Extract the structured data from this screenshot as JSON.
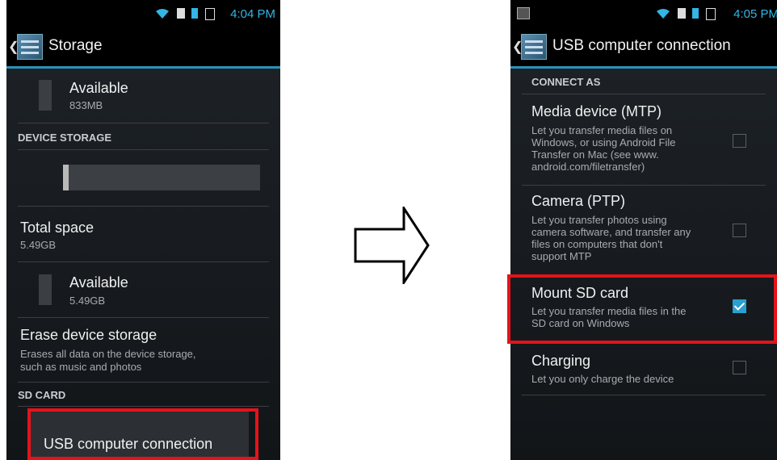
{
  "left": {
    "status": {
      "time": "4:04 PM"
    },
    "title": "Storage",
    "available1": {
      "label": "Available",
      "value": "833MB"
    },
    "device_storage_header": "DEVICE STORAGE",
    "device_storage_used_fraction": 0.03,
    "total_space": {
      "label": "Total space",
      "value": "5.49GB"
    },
    "available2": {
      "label": "Available",
      "value": "5.49GB"
    },
    "erase": {
      "label": "Erase device storage",
      "desc_line1": "Erases all data on the device storage,",
      "desc_line2": "such as music and photos"
    },
    "sd_card_header": "SD CARD",
    "usb_popup": "USB computer connection"
  },
  "right": {
    "status": {
      "time": "4:05 PM"
    },
    "title": "USB computer connection",
    "connect_as_header": "CONNECT AS",
    "options": [
      {
        "label": "Media device (MTP)",
        "desc": [
          "Let you transfer media files on",
          "Windows, or using Android File",
          "Transfer on Mac (see www.",
          "android.com/filetransfer)"
        ],
        "checked": false
      },
      {
        "label": "Camera (PTP)",
        "desc": [
          "Let you transfer photos using",
          "camera software, and transfer any",
          "files on computers that don't",
          "support MTP"
        ],
        "checked": false
      },
      {
        "label": "Mount SD card",
        "desc": [
          "Let you transfer media files in the",
          "SD card on Windows"
        ],
        "checked": true
      },
      {
        "label": "Charging",
        "desc": [
          "Let you only charge the device"
        ],
        "checked": false
      }
    ]
  },
  "colors": {
    "accent": "#33b5e5",
    "highlight": "#e4131a"
  }
}
